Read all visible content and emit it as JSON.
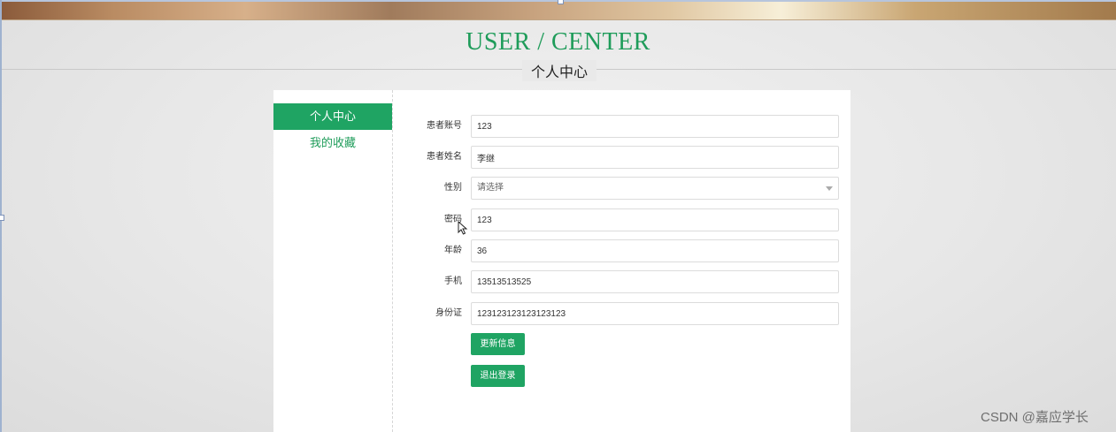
{
  "header": {
    "title_en": "USER / CENTER",
    "title_cn": "个人中心"
  },
  "sidebar": {
    "items": [
      {
        "label": "个人中心",
        "active": true
      },
      {
        "label": "我的收藏",
        "active": false
      }
    ]
  },
  "form": {
    "fields": [
      {
        "label": "患者账号",
        "value": "123"
      },
      {
        "label": "患者姓名",
        "value": "李继"
      },
      {
        "label": "性别",
        "placeholder": "请选择"
      },
      {
        "label": "密码",
        "value": "123"
      },
      {
        "label": "年龄",
        "value": "36"
      },
      {
        "label": "手机",
        "value": "13513513525"
      },
      {
        "label": "身份证",
        "value": "123123123123123123"
      }
    ],
    "update_button": "更新信息",
    "logout_button": "退出登录"
  },
  "watermark": "CSDN @嘉应学长",
  "colors": {
    "accent": "#1fa463",
    "title": "#1f9c5a"
  }
}
